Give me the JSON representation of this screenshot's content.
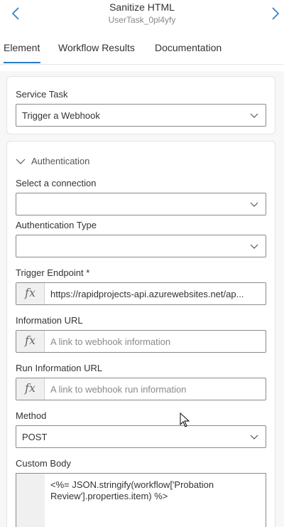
{
  "header": {
    "title": "Sanitize HTML",
    "subtitle": "UserTask_0pl4yfy"
  },
  "tabs": [
    {
      "label": "Element",
      "active": true
    },
    {
      "label": "Workflow Results",
      "active": false
    },
    {
      "label": "Documentation",
      "active": false
    }
  ],
  "service_task": {
    "label": "Service Task",
    "value": "Trigger a Webhook"
  },
  "authentication": {
    "section_label": "Authentication",
    "connection_label": "Select a connection",
    "connection_value": "",
    "auth_type_label": "Authentication Type",
    "auth_type_value": ""
  },
  "trigger_endpoint": {
    "label": "Trigger Endpoint",
    "required_mark": "*",
    "fx": "fx",
    "value": "https://rapidprojects-api.azurewebsites.net/ap..."
  },
  "information_url": {
    "label": "Information URL",
    "fx": "fx",
    "placeholder": "A link to webhook information"
  },
  "run_information_url": {
    "label": "Run Information URL",
    "fx": "fx",
    "placeholder": "A link to webhook run information"
  },
  "method": {
    "label": "Method",
    "value": "POST"
  },
  "custom_body": {
    "label": "Custom Body",
    "line1": "<%= JSON.stringify(workflow['Probation",
    "line2": "Review'].properties.item) %>"
  },
  "colors": {
    "accent": "#2b7cc4",
    "border": "#8a8a8a",
    "card_border": "#e3e3e3"
  },
  "icons": [
    "chevron-left-icon",
    "chevron-right-icon",
    "chevron-down-icon",
    "fx-icon",
    "mouse-cursor-icon"
  ]
}
